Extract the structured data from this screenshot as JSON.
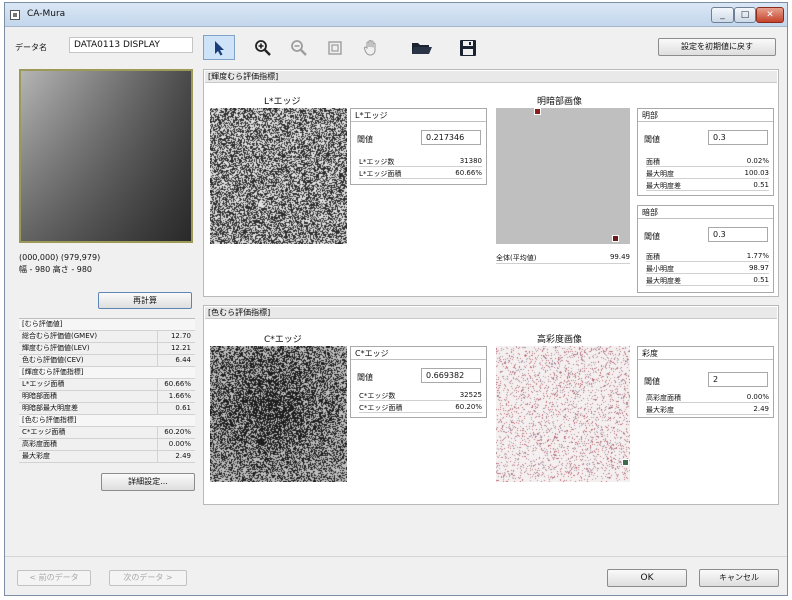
{
  "window": {
    "title": "CA-Mura",
    "minimize": "_",
    "maximize": "□",
    "close": "✕"
  },
  "data_name": {
    "label": "データ名",
    "value": "DATA0113 DISPLAY"
  },
  "toolbar": {
    "icons": [
      "cursor-icon",
      "zoom-in-icon",
      "zoom-out-icon",
      "fit-icon",
      "hand-icon",
      "folder-open-icon",
      "save-icon"
    ]
  },
  "reset_button": "設定を初期値に戻す",
  "preview": {
    "coords": "(000,000) (979,979)",
    "size": "幅 - 980 高さ - 980"
  },
  "recalc_button": "再計算",
  "eval_list": [
    {
      "label": "[むら評価値]",
      "value": "",
      "header": true
    },
    {
      "label": "総合むら評価値(GMEV)",
      "value": "12.70"
    },
    {
      "label": "輝度むら評価値(LEV)",
      "value": "12.21"
    },
    {
      "label": "色むら評価値(CEV)",
      "value": "6.44"
    },
    {
      "label": "[輝度むら評価指標]",
      "value": "",
      "header": true
    },
    {
      "label": "L*エッジ面積",
      "value": "60.66%"
    },
    {
      "label": "明暗部面積",
      "value": "1.66%"
    },
    {
      "label": "明暗部最大明度差",
      "value": "0.61"
    },
    {
      "label": "[色むら評価指標]",
      "value": "",
      "header": true
    },
    {
      "label": "C*エッジ面積",
      "value": "60.20%"
    },
    {
      "label": "高彩度面積",
      "value": "0.00%"
    },
    {
      "label": "最大彩度",
      "value": "2.49"
    }
  ],
  "detail_button": "詳細設定...",
  "luminance_panel": {
    "title": "[輝度むら評価指標]",
    "l_edge_image_label": "L*エッジ",
    "l_edge_box": {
      "title": "L*エッジ",
      "threshold_label": "閾値",
      "threshold_value": "0.217346",
      "rows": [
        {
          "label": "L*エッジ数",
          "value": "31380"
        },
        {
          "label": "L*エッジ面積",
          "value": "60.66%"
        }
      ]
    },
    "bright_dark_image_label": "明暗部画像",
    "average_label": "全体(平均値)",
    "average_value": "99.49",
    "bright_box": {
      "title": "明部",
      "threshold_label": "閾値",
      "threshold_value": "0.3",
      "rows": [
        {
          "label": "面積",
          "value": "0.02%"
        },
        {
          "label": "最大明度",
          "value": "100.03"
        },
        {
          "label": "最大明度差",
          "value": "0.51"
        }
      ]
    },
    "dark_box": {
      "title": "暗部",
      "threshold_label": "閾値",
      "threshold_value": "0.3",
      "rows": [
        {
          "label": "面積",
          "value": "1.77%"
        },
        {
          "label": "最小明度",
          "value": "98.97"
        },
        {
          "label": "最大明度差",
          "value": "0.51"
        }
      ]
    }
  },
  "color_panel": {
    "title": "[色むら評価指標]",
    "c_edge_image_label": "C*エッジ",
    "c_edge_box": {
      "title": "C*エッジ",
      "threshold_label": "閾値",
      "threshold_value": "0.669382",
      "rows": [
        {
          "label": "C*エッジ数",
          "value": "32525"
        },
        {
          "label": "C*エッジ面積",
          "value": "60.20%"
        }
      ]
    },
    "high_chroma_image_label": "高彩度画像",
    "chroma_box": {
      "title": "彩度",
      "threshold_label": "閾値",
      "threshold_value": "2",
      "rows": [
        {
          "label": "高彩度面積",
          "value": "0.00%"
        },
        {
          "label": "最大彩度",
          "value": "2.49"
        }
      ]
    }
  },
  "footer": {
    "prev": "< 前のデータ",
    "next": "次のデータ >",
    "ok": "OK",
    "cancel": "キャンセル"
  }
}
